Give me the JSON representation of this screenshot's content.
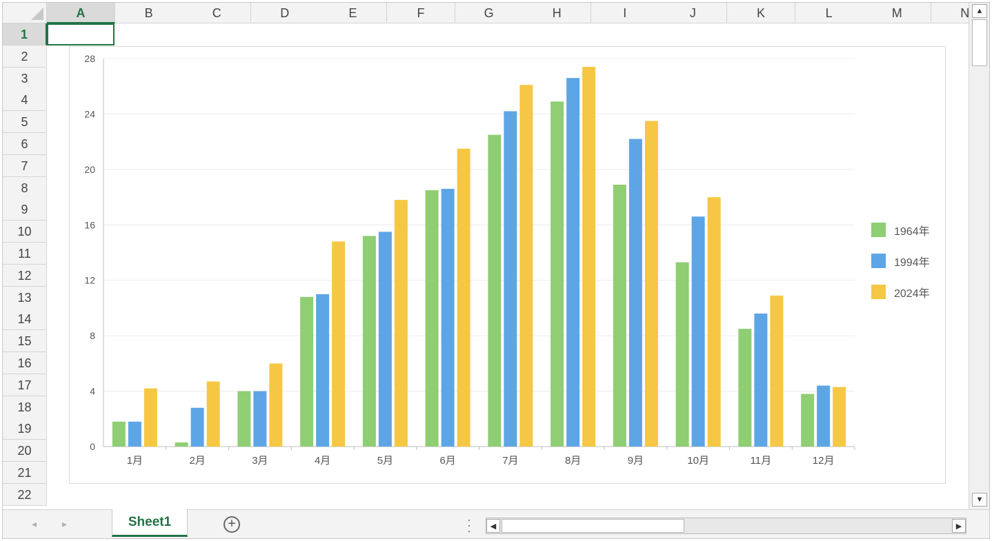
{
  "spreadsheet": {
    "columns": [
      "A",
      "B",
      "C",
      "D",
      "E",
      "F",
      "G",
      "H",
      "I",
      "J",
      "K",
      "L",
      "M",
      "N"
    ],
    "rows": [
      "1",
      "2",
      "3",
      "4",
      "5",
      "6",
      "7",
      "8",
      "9",
      "10",
      "11",
      "12",
      "13",
      "14",
      "15",
      "16",
      "17",
      "18",
      "19",
      "20",
      "21",
      "22"
    ],
    "active_column": "A",
    "active_row": "1"
  },
  "sheet_tabs": {
    "tabs": [
      "Sheet1"
    ],
    "active": "Sheet1",
    "add_sheet_icon": "plus-circle-icon"
  },
  "colors": {
    "accent": "#217346",
    "series": [
      "#8fce73",
      "#5ea5e6",
      "#f5c744"
    ]
  },
  "chart_data": {
    "type": "bar",
    "categories": [
      "1月",
      "2月",
      "3月",
      "4月",
      "5月",
      "6月",
      "7月",
      "8月",
      "9月",
      "10月",
      "11月",
      "12月"
    ],
    "series": [
      {
        "name": "1964年",
        "values": [
          1.8,
          0.3,
          4.0,
          10.8,
          15.2,
          18.5,
          22.5,
          24.9,
          18.9,
          13.3,
          8.5,
          3.8
        ]
      },
      {
        "name": "1994年",
        "values": [
          1.8,
          2.8,
          4.0,
          11.0,
          15.5,
          18.6,
          24.2,
          26.6,
          22.2,
          16.6,
          9.6,
          4.4
        ]
      },
      {
        "name": "2024年",
        "values": [
          4.2,
          4.7,
          6.0,
          14.8,
          17.8,
          21.5,
          26.1,
          27.4,
          23.5,
          18.0,
          10.9,
          4.3
        ]
      }
    ],
    "yticks": [
      "0",
      "4",
      "8",
      "12",
      "16",
      "20",
      "24",
      "28"
    ],
    "ylim": [
      0,
      28
    ],
    "grid": true,
    "legend": "right"
  }
}
